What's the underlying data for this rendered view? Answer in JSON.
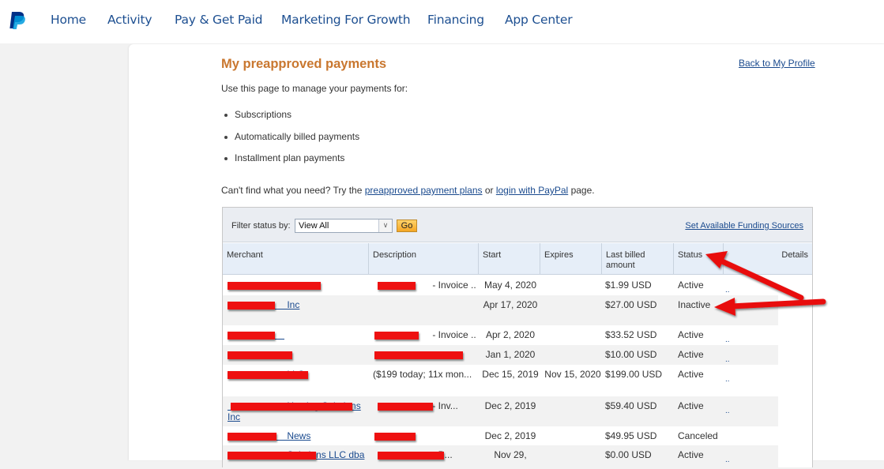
{
  "nav": {
    "logo": "paypal-logo",
    "items": [
      {
        "label": "Home"
      },
      {
        "label": "Activity"
      },
      {
        "label": "Pay & Get Paid"
      },
      {
        "label": "Marketing For Growth"
      },
      {
        "label": "Financing"
      },
      {
        "label": "App Center"
      }
    ]
  },
  "page": {
    "title": "My preapproved payments",
    "back_link": "Back to My Profile",
    "intro": "Use this page to manage your payments for:",
    "bullets": [
      "Subscriptions",
      "Automatically billed payments",
      "Installment plan payments"
    ],
    "cantfind_prefix": "Can't find what you need? Try the ",
    "cantfind_link1": "preapproved payment plans",
    "cantfind_mid": " or ",
    "cantfind_link2": "login with PayPal",
    "cantfind_suffix": " page."
  },
  "filter": {
    "label": "Filter status by:",
    "selected": "View All",
    "go_label": "Go",
    "funding_link": "Set Available Funding Sources"
  },
  "table": {
    "headers": [
      "Merchant",
      "Description",
      "Start",
      "Expires",
      "Last billed amount",
      "Status",
      "Details"
    ],
    "rows": [
      {
        "merchant": "[redacted]",
        "description": "[redacted] - Invoice ...",
        "start": "May 4, 2020",
        "expires": "",
        "amount": "$1.99 USD",
        "status": "Active",
        "details": ".."
      },
      {
        "merchant": "[redacted] Inc",
        "description": "",
        "start": "Apr 17, 2020",
        "expires": "",
        "amount": "$27.00 USD",
        "status": "Inactive",
        "details": ""
      },
      {
        "merchant": "[redacted]",
        "description": "[redacted] - Invoice ...",
        "start": "Apr 2, 2020",
        "expires": "",
        "amount": "$33.52 USD",
        "status": "Active",
        "details": ".."
      },
      {
        "merchant": "[redacted]",
        "description": "[redacted] ...",
        "start": "Jan 1, 2020",
        "expires": "",
        "amount": "$10.00 USD",
        "status": "Active",
        "details": ".."
      },
      {
        "merchant": "[redacted] LLC",
        "description": "($199 today; 11x mon...",
        "start": "Dec 15, 2019",
        "expires": "Nov 15, 2020",
        "amount": "$199.00 USD",
        "status": "Active",
        "details": ".."
      },
      {
        "merchant": "[redacted] Hosting Solutions Inc",
        "description": "[redacted] - Inv...",
        "start": "Dec 2, 2019",
        "expires": "",
        "amount": "$59.40 USD",
        "status": "Active",
        "details": ".."
      },
      {
        "merchant": "[redacted] News",
        "description": "[redacted]",
        "start": "Dec 2, 2019",
        "expires": "",
        "amount": "$49.95 USD",
        "status": "Canceled",
        "details": ""
      },
      {
        "merchant": "[redacted] Solutions LLC dba",
        "description": "[redacted] - B...",
        "start": "Nov 29,",
        "expires": "",
        "amount": "$0.00 USD",
        "status": "Active",
        "details": ".."
      }
    ]
  },
  "annotations": {
    "arrow_color": "#e81010",
    "arrows": [
      "arrow-to-status-header",
      "arrow-to-inactive-status"
    ]
  }
}
